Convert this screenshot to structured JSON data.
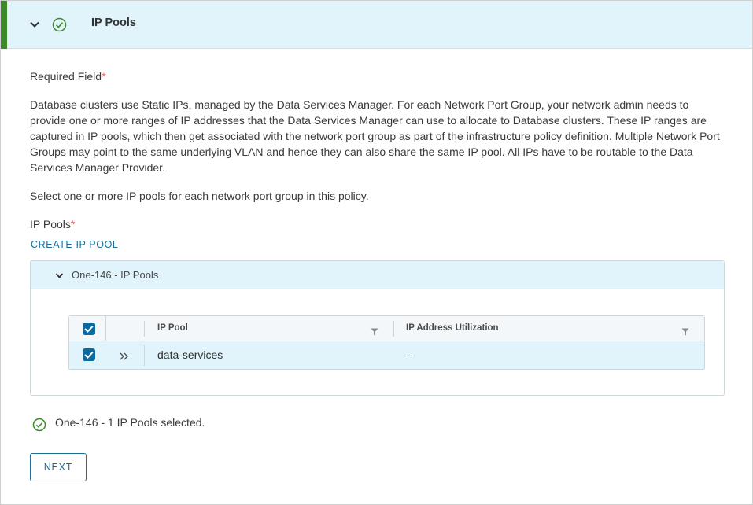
{
  "step": {
    "title": "IP Pools",
    "chevron_icon": "chevron-down-icon",
    "status_icon": "check-circle-icon",
    "accent_color": "#3c8a27"
  },
  "content": {
    "required_label": "Required Field",
    "required_marker": "*",
    "description": "Database clusters use Static IPs, managed by the Data Services Manager. For each Network Port Group, your network admin needs to provide one or more ranges of IP addresses that the Data Services Manager can use to allocate to Database clusters. These IP ranges are captured in IP pools, which then get associated with the network port group as part of the infrastructure policy definition. Multiple Network Port Groups may point to the same underlying VLAN and hence they can also share the same IP pool. All IPs have to be routable to the Data Services Manager Provider.",
    "instruction": "Select one or more IP pools for each network port group in this policy.",
    "field_label": "IP Pools",
    "field_marker": "*",
    "create_link": "CREATE IP POOL"
  },
  "group": {
    "title": "One-146 - IP Pools",
    "table": {
      "columns": [
        "IP Pool",
        "IP Address Utilization"
      ],
      "rows": [
        {
          "ip_pool": "data-services",
          "utilization": "-",
          "selected": true
        }
      ],
      "select_all": true
    }
  },
  "status": {
    "message": "One-146 - 1 IP Pools selected.",
    "icon": "check-circle-icon",
    "color": "#3c8a27"
  },
  "actions": {
    "next_label": "NEXT"
  }
}
